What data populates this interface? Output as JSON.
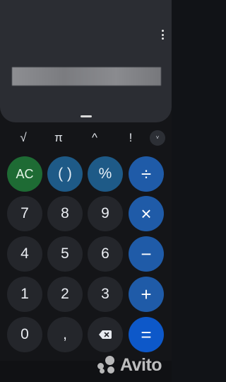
{
  "display": {
    "expression": " ",
    "menu_icon": "more-vertical-icon"
  },
  "scientific_row": {
    "keys": [
      "√",
      "π",
      "^",
      "!"
    ],
    "expand_icon": "chevron-down-icon",
    "expand_glyph": "˅"
  },
  "keypad": {
    "row1": [
      "AC",
      "( )",
      "%",
      "÷"
    ],
    "row2": [
      "7",
      "8",
      "9",
      "×"
    ],
    "row3": [
      "4",
      "5",
      "6",
      "−"
    ],
    "row4": [
      "1",
      "2",
      "3",
      "+"
    ],
    "row5": [
      "0",
      ",",
      "",
      "="
    ],
    "backspace_icon": "backspace-icon"
  },
  "watermark": {
    "text": "Avito",
    "icon": "avito-logo-icon"
  },
  "colors": {
    "ac": "#1e6b34",
    "function_keys": "#1e5a87",
    "operators": "#1f5ba8",
    "equals": "#0d58c9",
    "number_keys": "#24262b",
    "display_bg": "#2b2d33"
  }
}
